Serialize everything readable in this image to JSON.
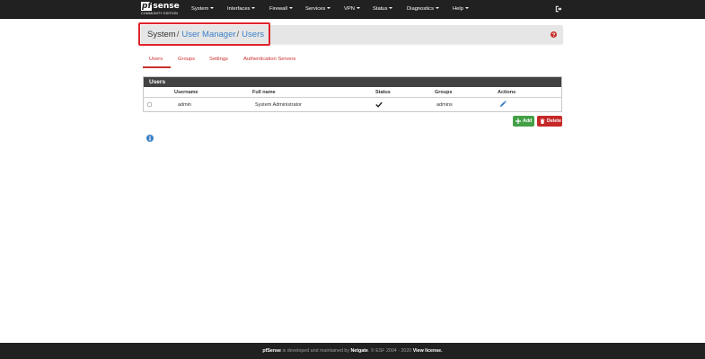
{
  "brand": {
    "logo_pf": "pf",
    "logo_sense": "sense",
    "subtitle": "COMMUNITY EDITION"
  },
  "nav": {
    "items": [
      {
        "label": "System"
      },
      {
        "label": "Interfaces"
      },
      {
        "label": "Firewall"
      },
      {
        "label": "Services"
      },
      {
        "label": "VPN"
      },
      {
        "label": "Status"
      },
      {
        "label": "Diagnostics"
      },
      {
        "label": "Help"
      }
    ],
    "logout_icon": "logout-icon"
  },
  "breadcrumb": {
    "root": "System",
    "separator": "/",
    "level1": "User Manager",
    "level2": "Users"
  },
  "tabs": [
    {
      "label": "Users",
      "active": true
    },
    {
      "label": "Groups"
    },
    {
      "label": "Settings"
    },
    {
      "label": "Authentication Servers"
    }
  ],
  "users_panel": {
    "title": "Users",
    "columns": [
      "Username",
      "Full name",
      "Status",
      "Groups",
      "Actions"
    ],
    "rows": [
      {
        "username": "admin",
        "full_name": "System Administrator",
        "status_icon": "check-icon",
        "groups": "admins",
        "action_icon": "pencil-icon"
      }
    ]
  },
  "buttons": {
    "add": "Add",
    "delete": "Delete"
  },
  "footer": {
    "brand": "pfSense",
    "text1": " is developed and maintained by ",
    "company": "Netgate",
    "text2": ". © ESF 2004 - 2020 ",
    "license": "View license."
  },
  "colors": {
    "navbar": "#212121",
    "accent_red": "#c9302c",
    "link_blue": "#3c80c7",
    "add_green": "#43a047",
    "delete_red": "#c62828",
    "highlight": "#e0232b"
  }
}
